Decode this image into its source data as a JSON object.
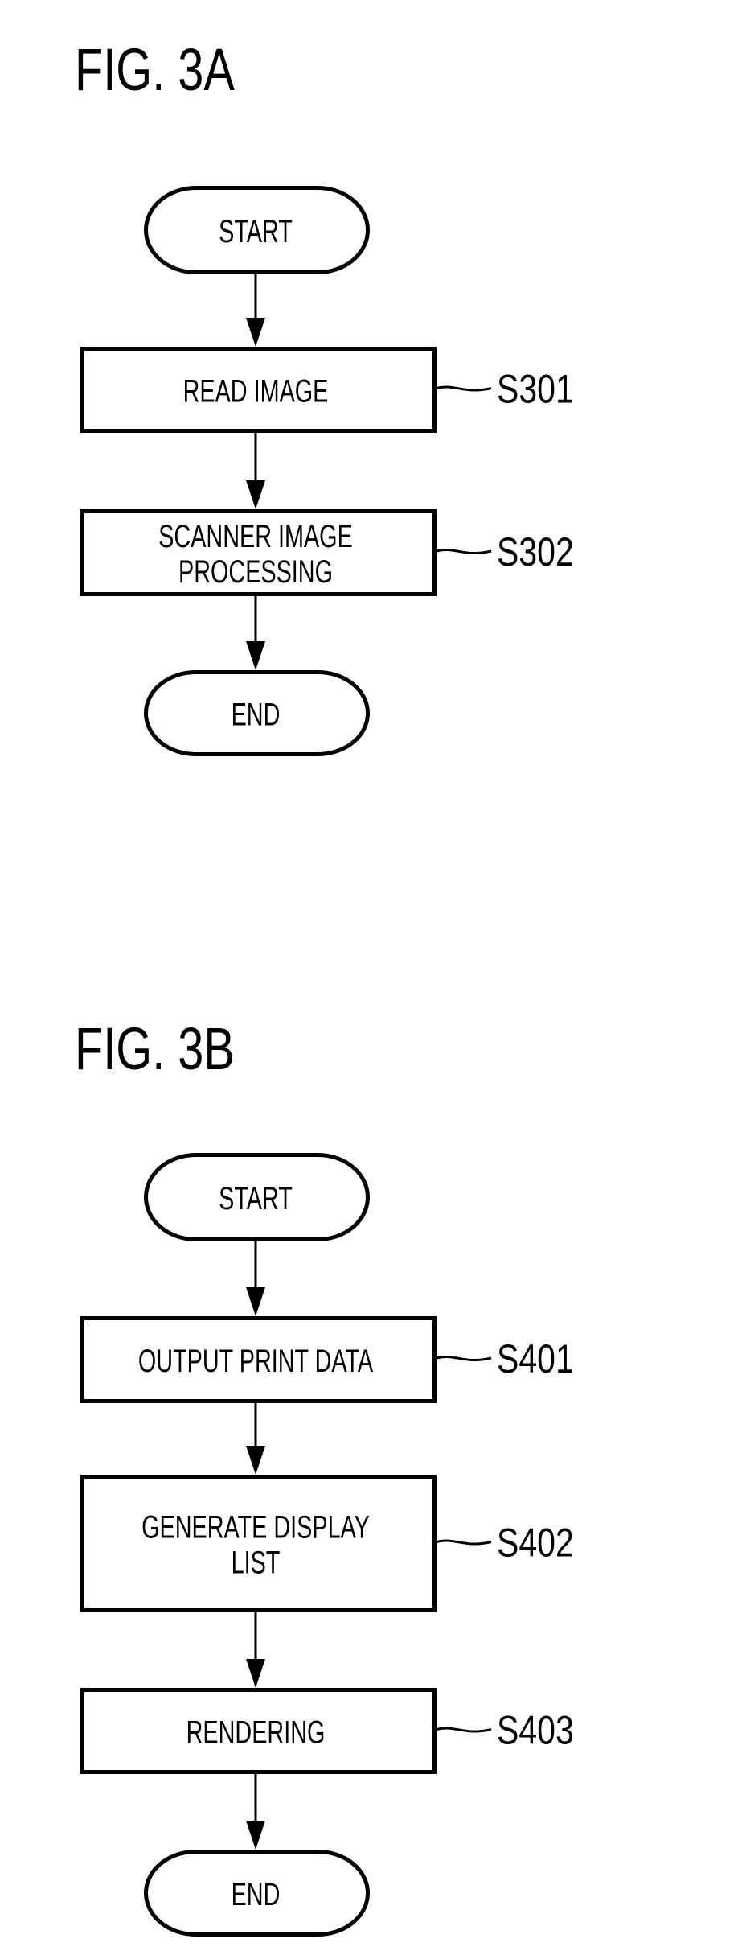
{
  "colors": {
    "ink": "#000000",
    "background": "#ffffff"
  },
  "figures": [
    {
      "title": "FIG. 3A",
      "nodes": [
        {
          "type": "terminal",
          "lines": [
            "START"
          ],
          "step": ""
        },
        {
          "type": "process",
          "lines": [
            "READ IMAGE"
          ],
          "step": "S301"
        },
        {
          "type": "process",
          "lines": [
            "SCANNER IMAGE",
            "PROCESSING"
          ],
          "step": "S302"
        },
        {
          "type": "terminal",
          "lines": [
            "END"
          ],
          "step": ""
        }
      ]
    },
    {
      "title": "FIG. 3B",
      "nodes": [
        {
          "type": "terminal",
          "lines": [
            "START"
          ],
          "step": ""
        },
        {
          "type": "process",
          "lines": [
            "OUTPUT PRINT DATA"
          ],
          "step": "S401"
        },
        {
          "type": "process",
          "lines": [
            "GENERATE DISPLAY",
            "LIST"
          ],
          "step": "S402"
        },
        {
          "type": "process",
          "lines": [
            "RENDERING"
          ],
          "step": "S403"
        },
        {
          "type": "terminal",
          "lines": [
            "END"
          ],
          "step": ""
        }
      ]
    }
  ]
}
